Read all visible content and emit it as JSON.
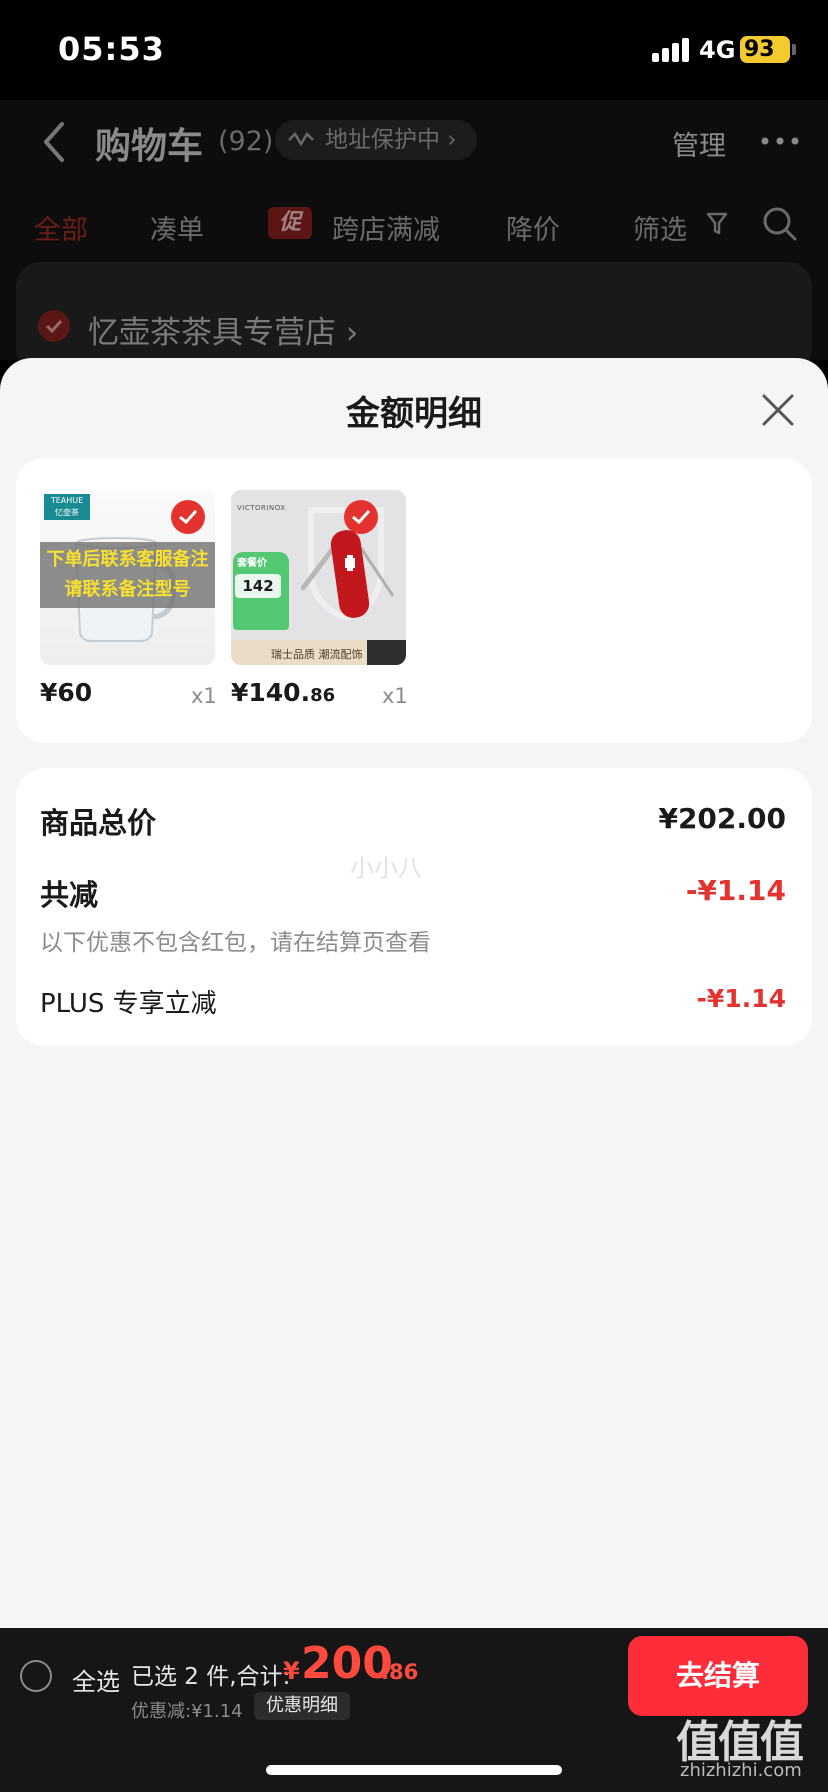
{
  "status_bar": {
    "time": "05:53",
    "network": "4G",
    "battery": "93"
  },
  "cart_header": {
    "title": "购物车",
    "count": "(92)",
    "address_protect": "地址保护中",
    "manage": "管理"
  },
  "tabs": [
    {
      "label": "全部"
    },
    {
      "label": "凑单"
    },
    {
      "badge": "促",
      "label": "跨店满减"
    },
    {
      "label": "降价"
    },
    {
      "label": "筛选"
    }
  ],
  "store": {
    "name": "忆壶茶茶具专营店"
  },
  "sheet": {
    "title": "金额明细",
    "products": [
      {
        "brand": "TEAHUE",
        "brand_cn": "忆壶茶",
        "overlay_line1": "下单后联系客服备注",
        "overlay_line2": "请联系备注型号",
        "price": "¥60",
        "qty": "x1"
      },
      {
        "brand": "VICTORINOX",
        "badge_title": "套餐价",
        "badge_price": "142",
        "banner": "瑞士品质 潮流配饰",
        "price_int": "¥140.",
        "price_dec": "86",
        "qty": "x1"
      }
    ],
    "summary": {
      "total_label": "商品总价",
      "total_value": "¥202.00",
      "reduce_label": "共减",
      "reduce_value": "-¥1.14",
      "note": "以下优惠不包含红包，请在结算页查看",
      "plus_label": "PLUS 专享立减",
      "plus_value": "-¥1.14",
      "watermark": "小小八"
    }
  },
  "bottom_bar": {
    "select_all": "全选",
    "selected_text": "已选 2 件,合计:",
    "total_currency": "¥",
    "total_int": "200",
    "total_dec": ".86",
    "discount": "优惠减:¥1.14",
    "detail_button": "优惠明细",
    "checkout": "去结算"
  },
  "site_logo": {
    "text": "值值值",
    "url": "zhizhizhi.com"
  },
  "colors": {
    "accent_red": "#e4332f",
    "checkout_red": "#ff2d3a",
    "battery_yellow": "#f3cb2e"
  }
}
